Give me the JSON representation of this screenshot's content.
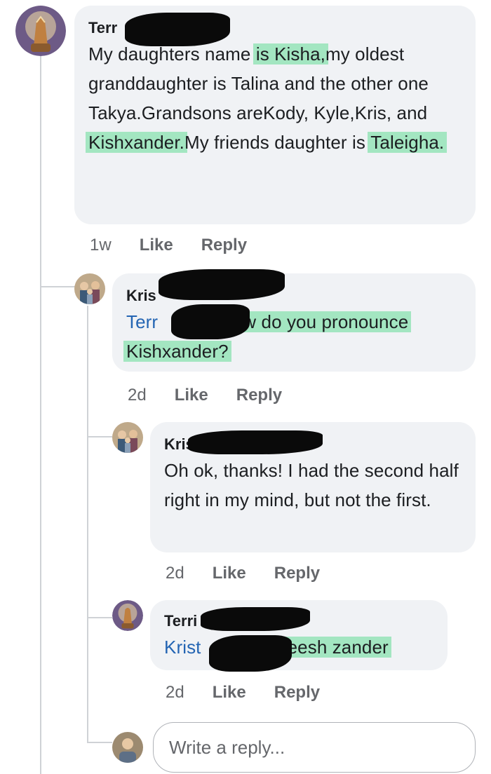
{
  "comments": [
    {
      "author": "Terr",
      "text_parts": [
        "My daughters name ",
        "is Kisha,",
        "my oldest granddaughter is Talina and the other one Takya.Grandsons areKody, Kyle,Kris, and ",
        "Kishxander.",
        "My friends daughter is ",
        "Taleigha."
      ],
      "actions": {
        "time": "1w",
        "like": "Like",
        "reply": "Reply"
      }
    },
    {
      "author": "Kris",
      "mention": "Terr",
      "text_parts": [
        "how do you pronounce Kishxander?"
      ],
      "actions": {
        "time": "2d",
        "like": "Like",
        "reply": "Reply"
      }
    },
    {
      "author": "Kris",
      "text_parts": [
        "Oh ok, thanks! I had the second half right in my mind, but not the first."
      ],
      "actions": {
        "time": "2d",
        "like": "Like",
        "reply": "Reply"
      }
    },
    {
      "author": "Terri",
      "mention": "Krist",
      "text_parts": [
        "keesh zander"
      ],
      "actions": {
        "time": "2d",
        "like": "Like",
        "reply": "Reply"
      }
    }
  ],
  "reply_box": {
    "placeholder": "Write a reply..."
  },
  "colors": {
    "bubble": "#f0f2f5",
    "mention": "#2465b3",
    "highlight": "#64dc96",
    "meta": "#65676b"
  },
  "icons": [
    "praying-hands-avatar-icon",
    "family-photo-avatar-icon",
    "user-avatar-icon"
  ]
}
